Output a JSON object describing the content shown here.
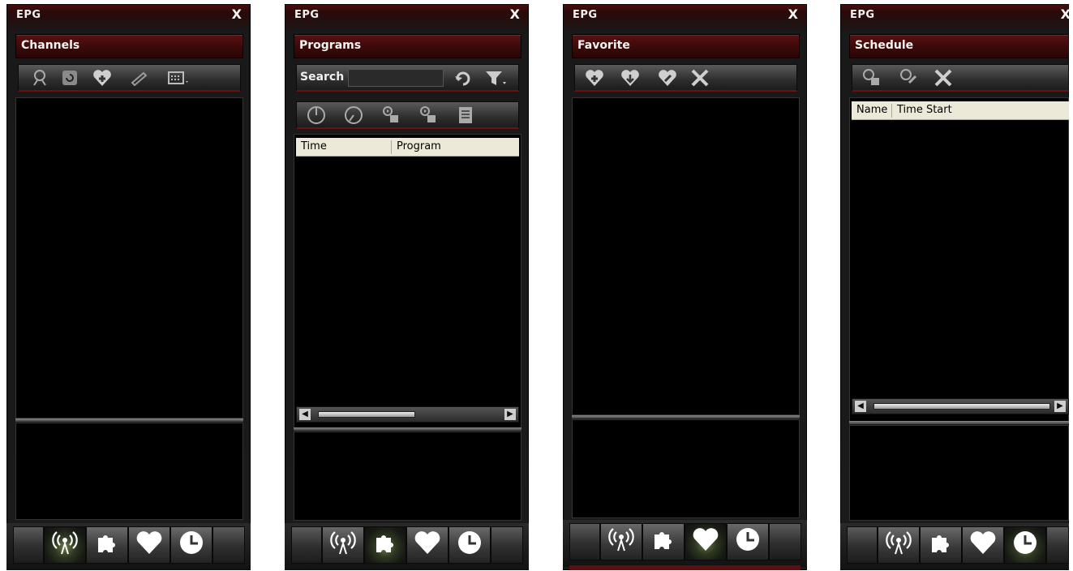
{
  "app_title": "EPG",
  "close_glyph": "X",
  "panels": [
    {
      "section": "Channels",
      "toolbar_icons": [
        "channel-scan-icon",
        "refresh-icon",
        "add-favorite-icon",
        "edit-icon",
        "grid-view-icon"
      ],
      "active_tab": "channels"
    },
    {
      "section": "Programs",
      "search_label": "Search",
      "search_value": "",
      "toolbar_icons": [
        "undo-icon",
        "filter-icon",
        "clock-icon",
        "clock-alt-icon",
        "record-icon",
        "record-alt-icon",
        "document-icon"
      ],
      "columns": [
        "Time",
        "Program"
      ],
      "active_tab": "programs"
    },
    {
      "section": "Favorite",
      "toolbar_icons": [
        "add-favorite-icon",
        "move-down-favorite-icon",
        "edit-favorite-icon",
        "delete-icon"
      ],
      "active_tab": "favorite"
    },
    {
      "section": "Schedule",
      "toolbar_icons": [
        "add-schedule-icon",
        "edit-schedule-icon",
        "delete-icon"
      ],
      "columns": [
        "Name",
        "Time Start"
      ],
      "active_tab": "schedule"
    }
  ],
  "tabs": [
    {
      "id": "channels",
      "icon": "broadcast-icon"
    },
    {
      "id": "programs",
      "icon": "puzzle-icon"
    },
    {
      "id": "favorite",
      "icon": "heart-icon"
    },
    {
      "id": "schedule",
      "icon": "clock-icon"
    }
  ],
  "colors": {
    "title_red": "#4a0f0f",
    "active_tab_glow": "#6a7d47",
    "list_bg": "#000000",
    "column_header_bg": "#ece9d8"
  }
}
